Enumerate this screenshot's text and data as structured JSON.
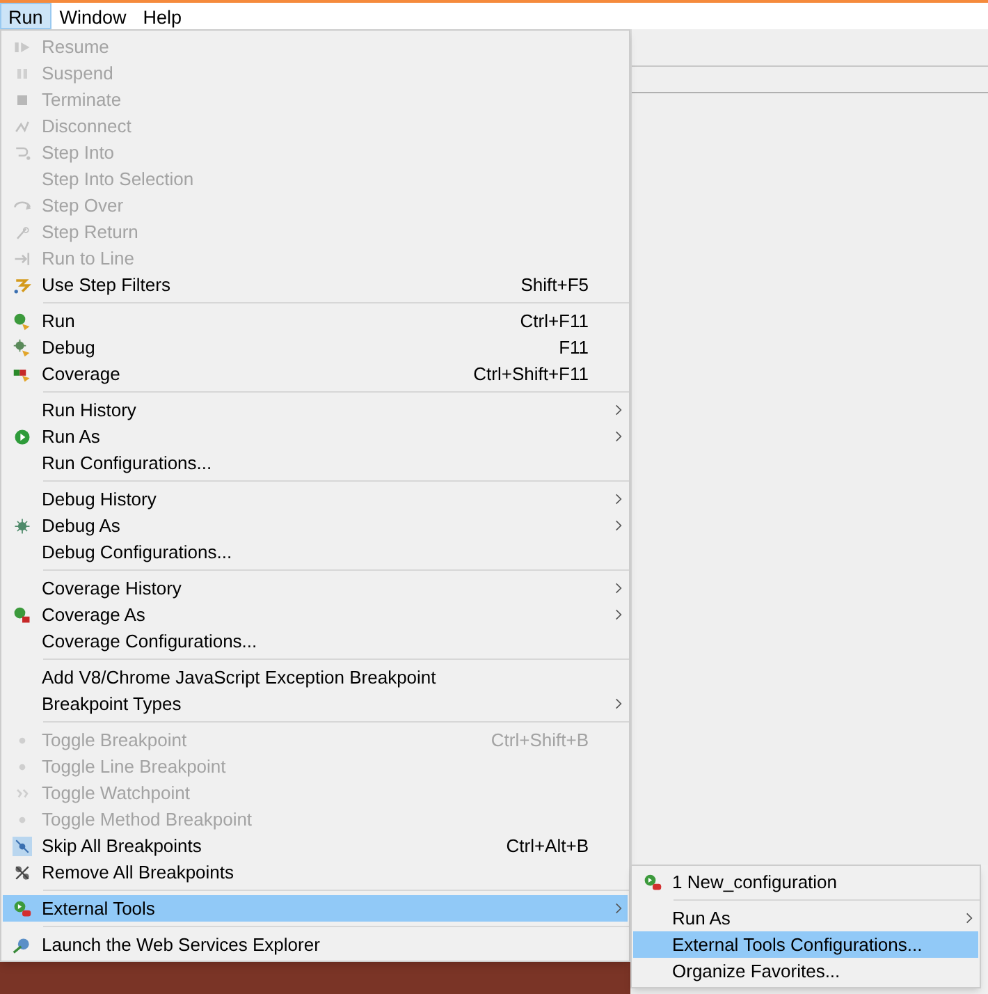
{
  "menu_bar": [
    {
      "label": "Run",
      "selected": true
    },
    {
      "label": "Window",
      "selected": false
    },
    {
      "label": "Help",
      "selected": false
    }
  ],
  "run_menu": {
    "sections": [
      [
        {
          "label": "Resume",
          "kind": "resume",
          "disabled": true,
          "selected": false,
          "submenu": false
        },
        {
          "label": "Suspend",
          "kind": "suspend",
          "disabled": true,
          "selected": false,
          "submenu": false
        },
        {
          "label": "Terminate",
          "kind": "terminate",
          "disabled": true,
          "selected": false,
          "submenu": false
        },
        {
          "label": "Disconnect",
          "kind": "disconnect",
          "disabled": true,
          "selected": false,
          "submenu": false
        },
        {
          "label": "Step Into",
          "kind": "step_into",
          "disabled": true,
          "selected": false,
          "submenu": false
        },
        {
          "label": "Step Into Selection",
          "kind": "plain",
          "disabled": true,
          "selected": false,
          "submenu": false
        },
        {
          "label": "Step Over",
          "kind": "step_over",
          "disabled": true,
          "selected": false,
          "submenu": false
        },
        {
          "label": "Step Return",
          "kind": "step_return",
          "disabled": true,
          "selected": false,
          "submenu": false
        },
        {
          "label": "Run to Line",
          "kind": "run_to_line",
          "disabled": true,
          "selected": false,
          "submenu": false
        },
        {
          "label": "Use Step Filters",
          "shortcut": "Shift+F5",
          "kind": "step_filters",
          "disabled": false,
          "selected": false,
          "submenu": false
        }
      ],
      [
        {
          "label": "Run",
          "shortcut": "Ctrl+F11",
          "kind": "run",
          "disabled": false,
          "selected": false,
          "submenu": false
        },
        {
          "label": "Debug",
          "shortcut": "F11",
          "kind": "debug",
          "disabled": false,
          "selected": false,
          "submenu": false
        },
        {
          "label": "Coverage",
          "shortcut": "Ctrl+Shift+F11",
          "kind": "coverage",
          "disabled": false,
          "selected": false,
          "submenu": false
        }
      ],
      [
        {
          "label": "Run History",
          "kind": "plain",
          "disabled": false,
          "selected": false,
          "submenu": true
        },
        {
          "label": "Run As",
          "kind": "run_as",
          "disabled": false,
          "selected": false,
          "submenu": true
        },
        {
          "label": "Run Configurations...",
          "kind": "plain",
          "disabled": false,
          "selected": false,
          "submenu": false
        }
      ],
      [
        {
          "label": "Debug History",
          "kind": "plain",
          "disabled": false,
          "selected": false,
          "submenu": true
        },
        {
          "label": "Debug As",
          "kind": "debug_as",
          "disabled": false,
          "selected": false,
          "submenu": true
        },
        {
          "label": "Debug Configurations...",
          "kind": "plain",
          "disabled": false,
          "selected": false,
          "submenu": false
        }
      ],
      [
        {
          "label": "Coverage History",
          "kind": "plain",
          "disabled": false,
          "selected": false,
          "submenu": true
        },
        {
          "label": "Coverage As",
          "kind": "coverage_as",
          "disabled": false,
          "selected": false,
          "submenu": true
        },
        {
          "label": "Coverage Configurations...",
          "kind": "plain",
          "disabled": false,
          "selected": false,
          "submenu": false
        }
      ],
      [
        {
          "label": "Add V8/Chrome JavaScript Exception Breakpoint",
          "kind": "plain",
          "disabled": false,
          "selected": false,
          "submenu": false
        },
        {
          "label": "Breakpoint Types",
          "kind": "plain",
          "disabled": false,
          "selected": false,
          "submenu": true
        }
      ],
      [
        {
          "label": "Toggle Breakpoint",
          "shortcut": "Ctrl+Shift+B",
          "kind": "breakpoint",
          "disabled": true,
          "selected": false,
          "submenu": false
        },
        {
          "label": "Toggle Line Breakpoint",
          "kind": "breakpoint",
          "disabled": true,
          "selected": false,
          "submenu": false
        },
        {
          "label": "Toggle Watchpoint",
          "kind": "watchpoint",
          "disabled": true,
          "selected": false,
          "submenu": false
        },
        {
          "label": "Toggle Method Breakpoint",
          "kind": "breakpoint",
          "disabled": true,
          "selected": false,
          "submenu": false
        },
        {
          "label": "Skip All Breakpoints",
          "shortcut": "Ctrl+Alt+B",
          "kind": "skip_breakpoints",
          "disabled": false,
          "selected": false,
          "submenu": false
        },
        {
          "label": "Remove All Breakpoints",
          "kind": "remove_breakpoints",
          "disabled": false,
          "selected": false,
          "submenu": false
        }
      ],
      [
        {
          "label": "External Tools",
          "kind": "external_tools",
          "disabled": false,
          "selected": true,
          "submenu": true
        }
      ],
      [
        {
          "label": "Launch the Web Services Explorer",
          "kind": "web_services",
          "disabled": false,
          "selected": false,
          "submenu": false
        }
      ]
    ]
  },
  "external_tools_submenu": {
    "sections": [
      [
        {
          "label": "1 New_configuration",
          "kind": "external_tools",
          "disabled": false,
          "selected": false,
          "submenu": false
        }
      ],
      [
        {
          "label": "Run As",
          "kind": "plain",
          "disabled": false,
          "selected": false,
          "submenu": true
        },
        {
          "label": "External Tools Configurations...",
          "kind": "plain",
          "disabled": false,
          "selected": true,
          "submenu": false
        },
        {
          "label": "Organize Favorites...",
          "kind": "plain",
          "disabled": false,
          "selected": false,
          "submenu": false
        }
      ]
    ]
  }
}
